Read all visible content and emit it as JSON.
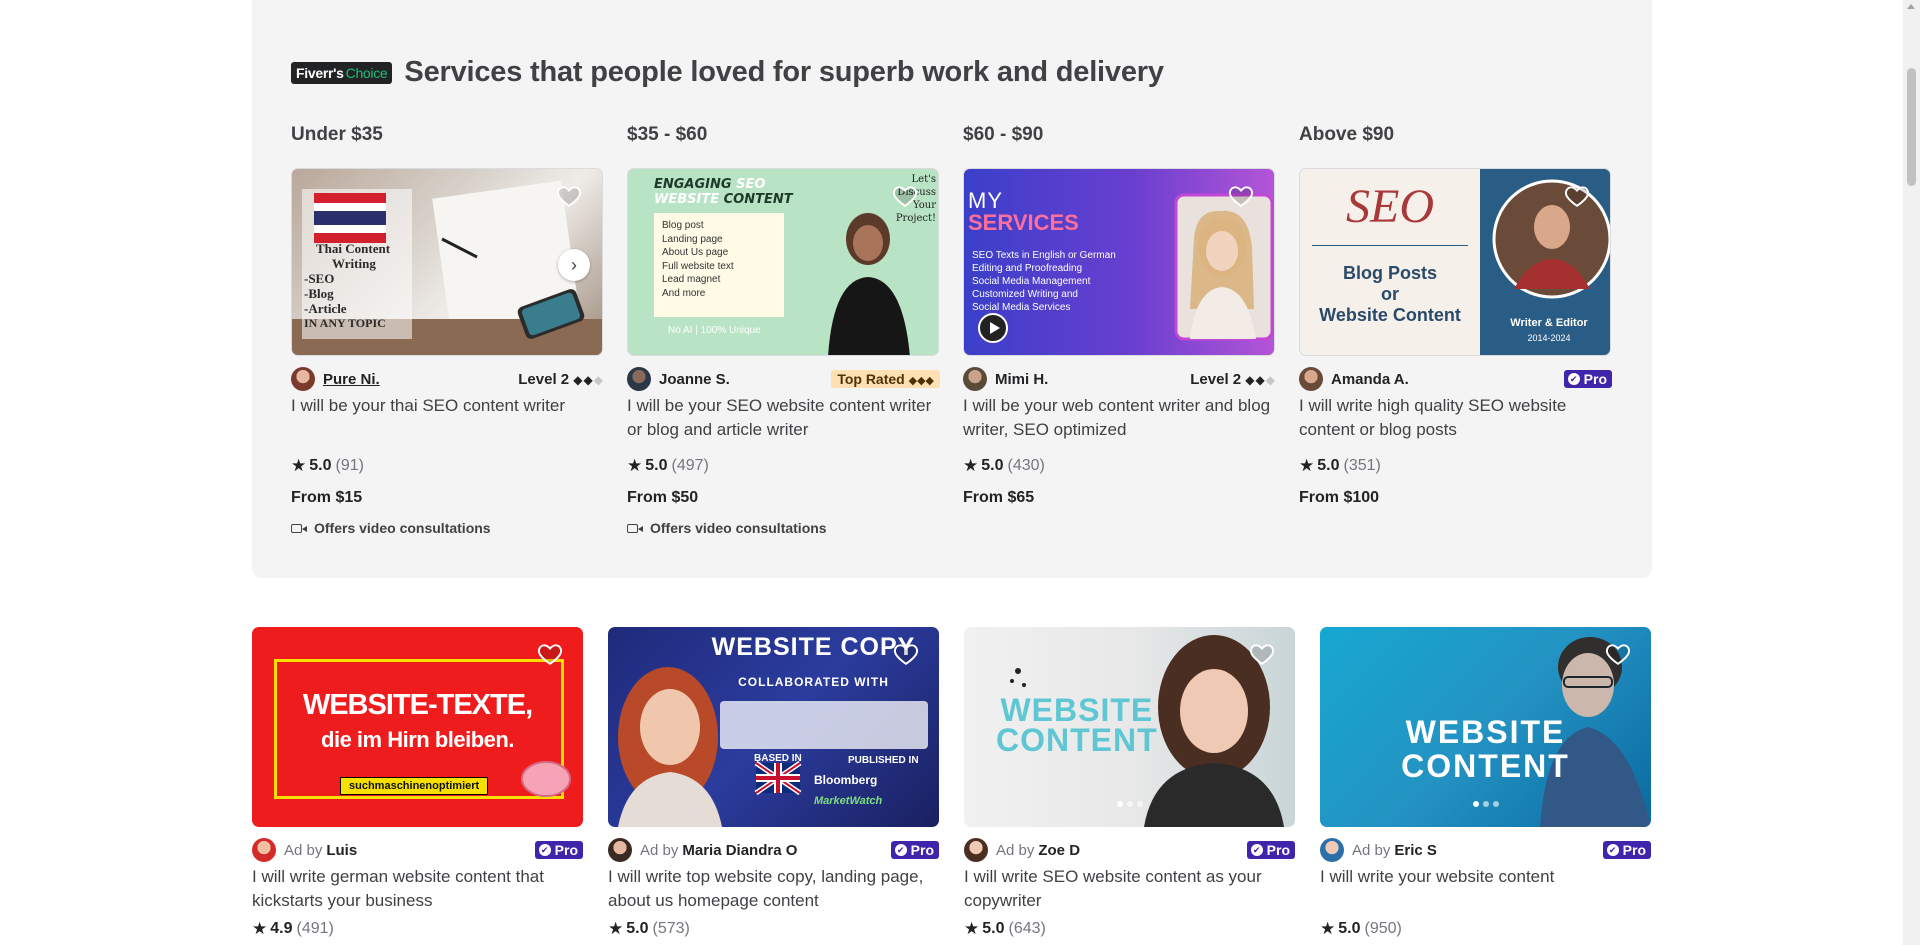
{
  "choice_section": {
    "badge_brand": "Fiverr's",
    "badge_word": "Choice",
    "title": "Services that people loved for superb work and delivery",
    "columns": [
      {
        "heading": "Under $35",
        "seller": "Pure Ni.",
        "level": "Level 2",
        "title": "I will be your thai SEO content writer",
        "rating": "5.0",
        "reviews": "(91)",
        "price": "From $15",
        "video": "Offers video consultations",
        "image_text": [
          "Thai Content",
          "Writing",
          "-SEO",
          "-Blog",
          "-Article",
          "IN ANY TOPIC"
        ]
      },
      {
        "heading": "$35 - $60",
        "seller": "Joanne S.",
        "badge": "Top Rated",
        "title": "I will be your SEO website content writer or blog and article writer",
        "rating": "5.0",
        "reviews": "(497)",
        "price": "From $50",
        "video": "Offers video consultations",
        "image_text": {
          "headline1": "ENGAGING",
          "headline_accent": "SEO",
          "headline2": "WEBSITE",
          "headline3": "CONTENT",
          "corner": "Let's Discuss Your Project!",
          "bullets": [
            "Blog post",
            "Landing page",
            "About Us page",
            "Full website text",
            "Lead magnet",
            "And more"
          ],
          "footer": "No AI | 100% Unique"
        }
      },
      {
        "heading": "$60 - $90",
        "seller": "Mimi H.",
        "level": "Level 2",
        "title": "I will be your web content writer and blog writer, SEO optimized",
        "rating": "5.0",
        "reviews": "(430)",
        "price": "From $65",
        "image_text": {
          "my": "MY",
          "services": "SERVICES",
          "lines": [
            "SEO Texts in English or German",
            "Editing and Proofreading",
            "Social Media Management",
            "Customized Writing and",
            "Social Media Services"
          ]
        }
      },
      {
        "heading": "Above $90",
        "seller": "Amanda A.",
        "badge": "Pro",
        "title": "I will write high quality SEO website content or blog posts",
        "rating": "5.0",
        "reviews": "(351)",
        "price": "From $100",
        "image_text": {
          "seo": "SEO",
          "line1": "Blog Posts",
          "line2": "or",
          "line3": "Website Content",
          "role": "Writer & Editor",
          "years": "2014-2024"
        }
      }
    ]
  },
  "ad_row": [
    {
      "ad_by": "Ad by",
      "seller": "Luis",
      "badge": "Pro",
      "title": "I will write german website content that kickstarts your business",
      "rating": "4.9",
      "reviews": "(491)",
      "image_text": {
        "line1": "WEBSITE-TEXTE,",
        "line2": "die im Hirn bleiben.",
        "tag": "suchmaschinenoptimiert"
      }
    },
    {
      "ad_by": "Ad by",
      "seller": "Maria Diandra O",
      "badge": "Pro",
      "title": "I will write top website copy, landing page, about us homepage content",
      "rating": "5.0",
      "reviews": "(573)",
      "image_text": {
        "line1": "WEBSITE COPY",
        "line2": "COLLABORATED WITH",
        "based": "BASED IN",
        "published": "PUBLISHED IN",
        "pub1": "Bloomberg",
        "pub2": "MarketWatch"
      }
    },
    {
      "ad_by": "Ad by",
      "seller": "Zoe D",
      "badge": "Pro",
      "title": "I will write SEO website content as your copywriter",
      "rating": "5.0",
      "reviews": "(643)",
      "image_text": {
        "line1": "WEBSITE",
        "line2": "CONTENT"
      }
    },
    {
      "ad_by": "Ad by",
      "seller": "Eric S",
      "badge": "Pro",
      "title": "I will write your website content",
      "rating": "5.0",
      "reviews": "(950)",
      "image_text": {
        "line1": "WEBSITE",
        "line2": "CONTENT"
      }
    }
  ]
}
